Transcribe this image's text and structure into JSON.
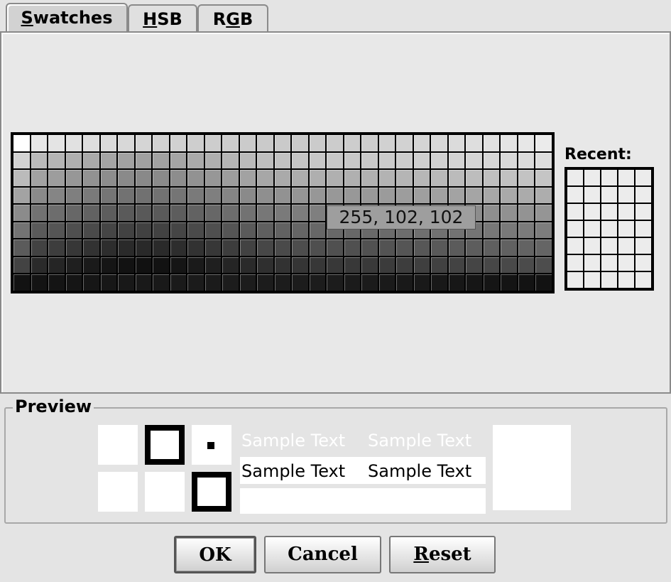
{
  "tabs": [
    {
      "mnemonic": "S",
      "rest": "watches",
      "selected": true
    },
    {
      "mnemonic": "H",
      "rest": "SB",
      "selected": false
    },
    {
      "pre": "R",
      "mnemonic": "G",
      "rest": "B",
      "selected": false
    }
  ],
  "swatches": {
    "rows": 9,
    "cols": 31,
    "tooltip": "255, 102, 102"
  },
  "recent": {
    "label": "Recent:",
    "rows": 7,
    "cols": 5
  },
  "preview": {
    "label": "Preview",
    "sample_text": "Sample Text",
    "sample_text_color": "#000000",
    "sample_text_faded_color": "#ffffff"
  },
  "buttons": {
    "ok": "OK",
    "cancel": "Cancel",
    "reset_mnemonic": "R",
    "reset_rest": "eset"
  }
}
